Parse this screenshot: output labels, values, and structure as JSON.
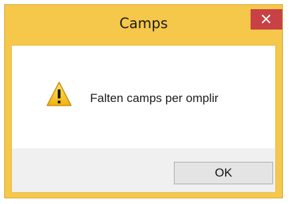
{
  "dialog": {
    "title": "Camps",
    "message": "Falten camps per omplir",
    "ok_label": "OK",
    "icon": "warning-icon",
    "close_icon": "close-icon"
  },
  "colors": {
    "frame": "#f5c74a",
    "close_button": "#c74145",
    "button_area": "#f0f0f0"
  }
}
